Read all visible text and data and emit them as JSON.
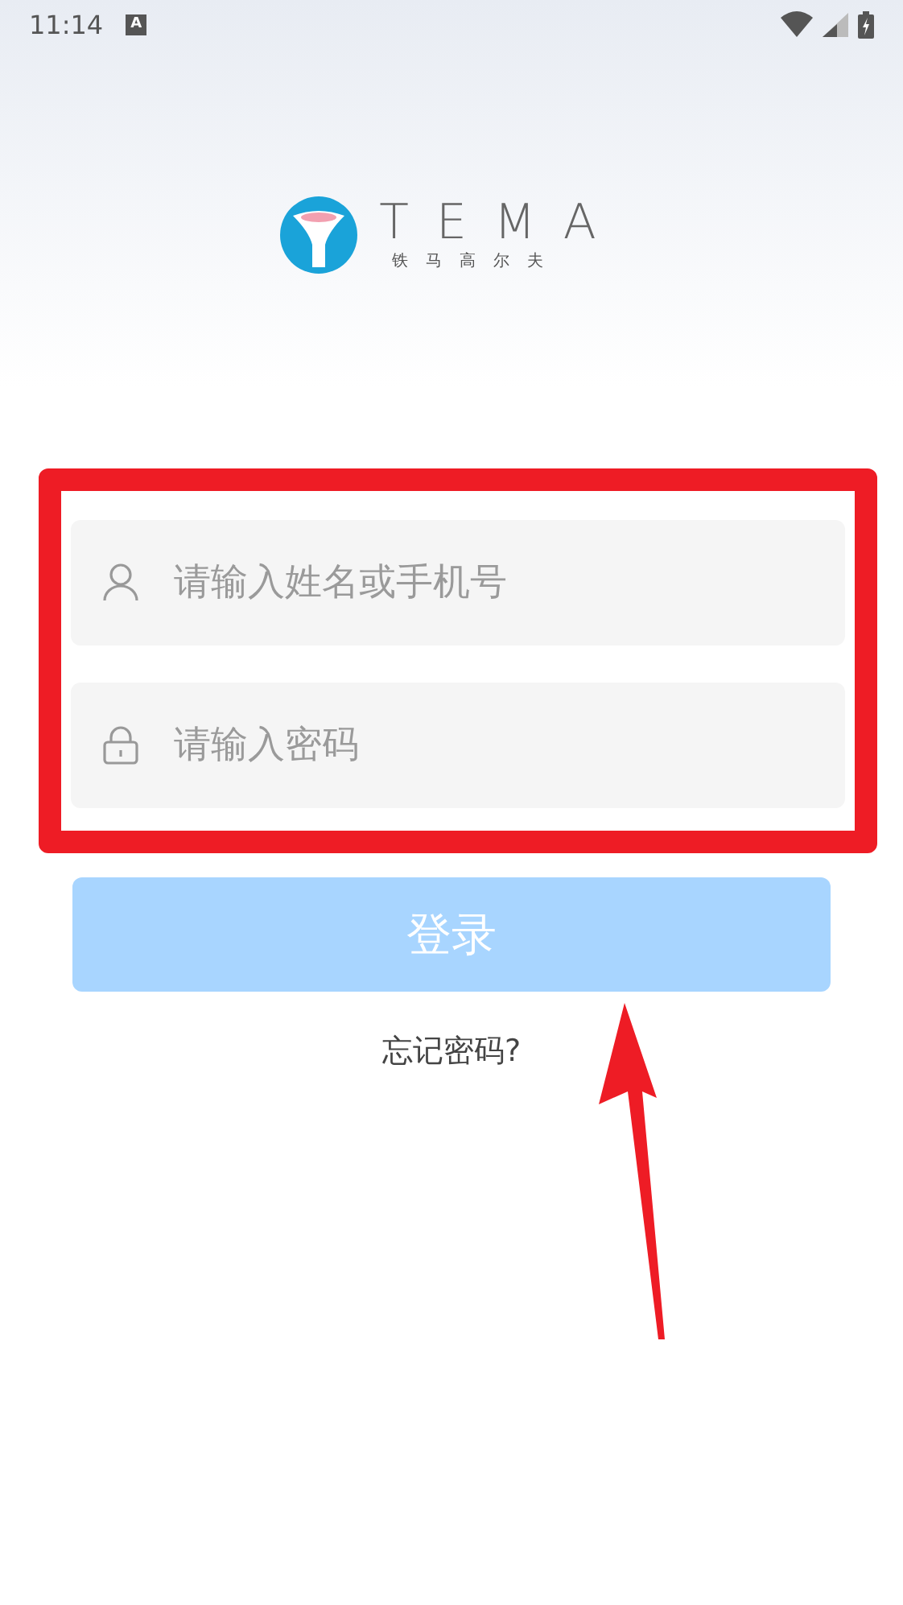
{
  "status_bar": {
    "time": "11:14",
    "notification": "A"
  },
  "logo": {
    "wordmark": "TEMA",
    "tagline": "铁马高尔夫"
  },
  "form": {
    "fields": [
      {
        "kind": "user",
        "placeholder": "请输入姓名或手机号"
      },
      {
        "kind": "password",
        "placeholder": "请输入密码"
      }
    ],
    "login_button": {
      "label": "登录",
      "disabled": true
    },
    "forgot_link": "忘记密码?"
  }
}
